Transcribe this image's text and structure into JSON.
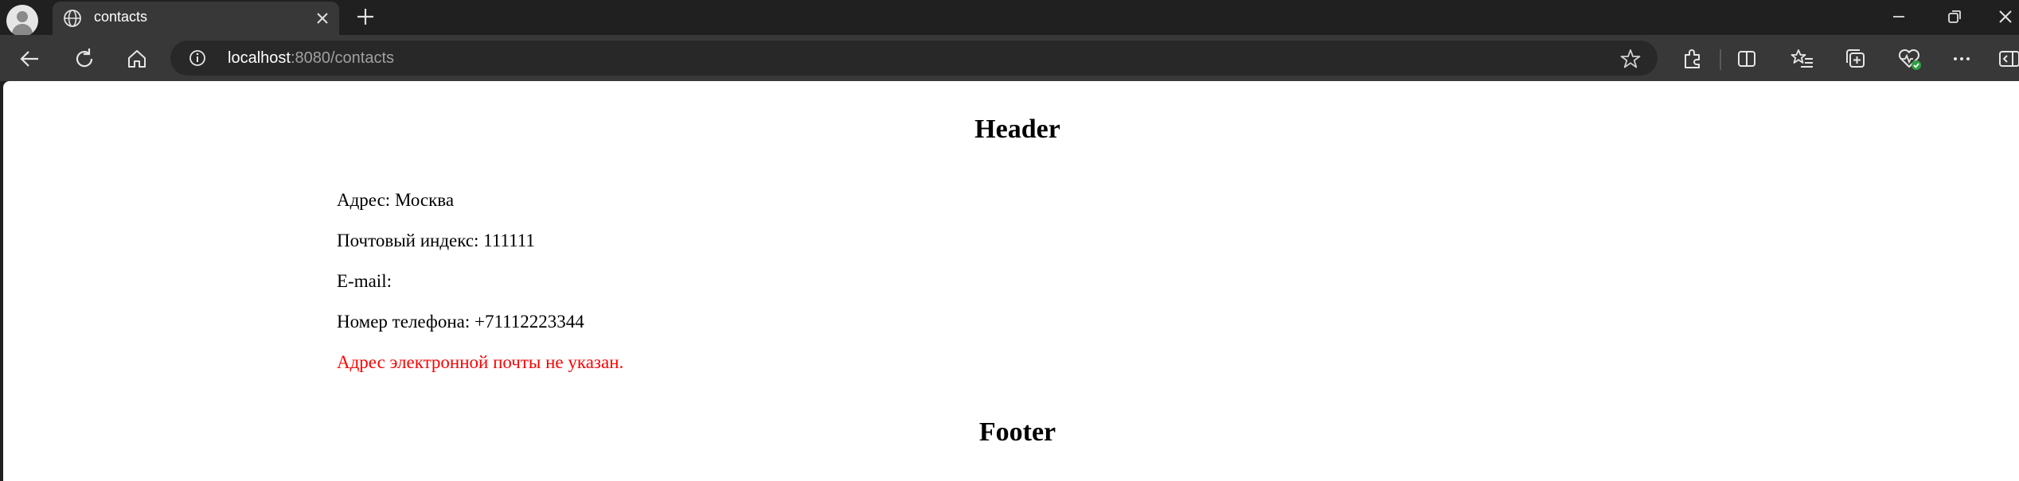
{
  "browser": {
    "tab": {
      "title": "contacts"
    },
    "address": {
      "host": "localhost",
      "path": ":8080/contacts"
    }
  },
  "page": {
    "header": "Header",
    "lines": [
      "Адрес: Москва",
      "Почтовый индекс: 111111",
      "E-mail:",
      "Номер телефона: +71112223344"
    ],
    "error": "Адрес электронной почты не указан.",
    "footer": "Footer"
  },
  "colors": {
    "error": "#ff0000",
    "titlebar": "#202020",
    "toolbar": "#383838",
    "page": "#ffffff"
  },
  "icons": [
    "profile-icon",
    "globe-icon",
    "close-icon",
    "plus-icon",
    "minimize-icon",
    "restore-icon",
    "window-close-icon",
    "back-icon",
    "refresh-icon",
    "home-icon",
    "info-icon",
    "star-icon",
    "extensions-icon",
    "split-screen-icon",
    "favorites-icon",
    "collections-icon",
    "browser-essentials-icon",
    "more-icon",
    "sidebar-icon"
  ]
}
